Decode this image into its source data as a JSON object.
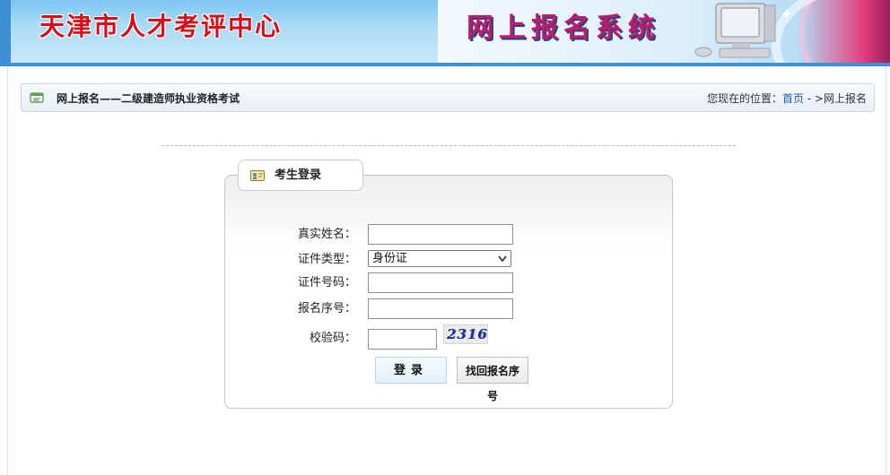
{
  "banner": {
    "org_title": "天津市人才考评中心",
    "system_title": "网上报名系统"
  },
  "nav": {
    "page_title": "网上报名——二级建造师执业资格考试",
    "location_prefix": "您现在的位置：",
    "home_link": "首页",
    "separator": " - >",
    "current": "网上报名"
  },
  "login": {
    "heading": "考生登录",
    "fields": {
      "name_label": "真实姓名：",
      "name_value": "",
      "id_type_label": "证件类型：",
      "id_type_selected": "身份证",
      "id_number_label": "证件号码：",
      "id_number_value": "",
      "reg_number_label": "报名序号：",
      "reg_number_value": "",
      "captcha_label": "校验码：",
      "captcha_value": "",
      "captcha_image_text": "2316"
    },
    "buttons": {
      "login": "登录",
      "find_reg_number": "找回报名序号"
    }
  },
  "colors": {
    "accent_blue": "#3a93da",
    "title_red": "#d80c18",
    "system_title_pink": "#c4176d",
    "link_blue": "#1a5aa8"
  },
  "icons": {
    "nav": "id-card-icon",
    "tab": "user-card-icon",
    "select": "chevron-down-icon",
    "banner": "computer-monitor-icon"
  }
}
